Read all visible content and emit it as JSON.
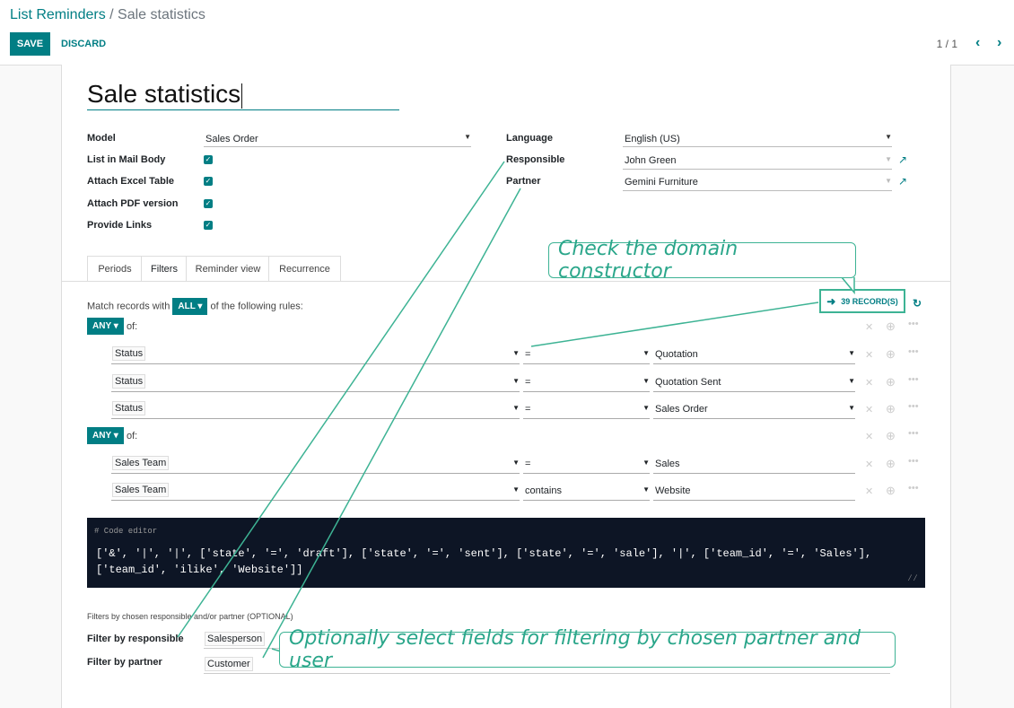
{
  "breadcrumb": {
    "parent": "List Reminders",
    "separator": " / ",
    "current": "Sale statistics"
  },
  "toolbar": {
    "save_label": "SAVE",
    "discard_label": "DISCARD",
    "pager": "1 / 1"
  },
  "icons": {
    "prev": "chevron-left-icon",
    "next": "chevron-right-icon",
    "external": "external-link-icon",
    "arrow": "arrow-right-icon",
    "refresh": "refresh-icon",
    "delete": "close-icon",
    "add": "plus-circle-icon",
    "more": "ellipsis-icon"
  },
  "form": {
    "name": "Sale statistics",
    "labels": {
      "model": "Model",
      "list_in_body": "List in Mail Body",
      "attach_excel": "Attach Excel Table",
      "attach_pdf": "Attach PDF version",
      "provide_links": "Provide Links",
      "language": "Language",
      "responsible": "Responsible",
      "partner": "Partner"
    },
    "values": {
      "model": "Sales Order",
      "language": "English (US)",
      "responsible": "John Green",
      "partner": "Gemini Furniture"
    },
    "checkboxes": {
      "list_in_body": true,
      "attach_excel": true,
      "attach_pdf": true,
      "provide_links": true
    }
  },
  "tabs": [
    {
      "label": "Periods"
    },
    {
      "label": "Filters"
    },
    {
      "label": "Reminder view"
    },
    {
      "label": "Recurrence"
    }
  ],
  "active_tab": "Filters",
  "filters": {
    "match_prefix": "Match records with",
    "match_mode": "ALL",
    "match_suffix": "of the following rules:",
    "records_label": "39 RECORD(S)",
    "groups": [
      {
        "mode": "ANY",
        "of": "of:",
        "rules": [
          {
            "field": "Status",
            "op": "=",
            "value": "Quotation"
          },
          {
            "field": "Status",
            "op": "=",
            "value": "Quotation Sent"
          },
          {
            "field": "Status",
            "op": "=",
            "value": "Sales Order"
          }
        ]
      },
      {
        "mode": "ANY",
        "of": "of:",
        "rules": [
          {
            "field": "Sales Team",
            "op": "=",
            "value": "Sales"
          },
          {
            "field": "Sales Team",
            "op": "contains",
            "value": "Website"
          }
        ]
      }
    ],
    "code_header": "# Code editor",
    "code": "['&', '|', '|', ['state', '=', 'draft'], ['state', '=', 'sent'], ['state', '=', 'sale'], '|', ['team_id', '=', 'Sales'], ['team_id', 'ilike', 'Website']]",
    "optional_title": "Filters by chosen responsible and/or partner (OPTIONAL)",
    "filter_by_responsible_label": "Filter by responsible",
    "filter_by_responsible_value": "Salesperson",
    "filter_by_partner_label": "Filter by partner",
    "filter_by_partner_value": "Customer"
  },
  "callouts": {
    "domain": "Check the domain constructor",
    "optional": "Optionally select fields for filtering by chosen partner and user"
  },
  "colors": {
    "accent": "#017e84",
    "callout": "#3db394",
    "code_bg": "#0d1525"
  }
}
